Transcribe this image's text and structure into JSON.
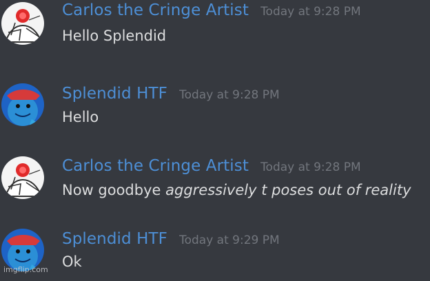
{
  "users": {
    "carlos": "Carlos the Cringe Artist",
    "splendid": "Splendid HTF"
  },
  "messages": [
    {
      "author": "Carlos the Cringe Artist",
      "timestamp": "Today at 9:28 PM",
      "text": "Hello Splendid",
      "avatar_icon": "sketch-character-avatar-icon"
    },
    {
      "author": "Splendid HTF",
      "timestamp": "Today at 9:28 PM",
      "text": "Hello",
      "avatar_icon": "blue-squirrel-avatar-icon"
    },
    {
      "author": "Carlos the Cringe Artist",
      "timestamp": "Today at 9:28 PM",
      "text_plain": "Now goodbye ",
      "text_italic": "aggressively t poses out of reality",
      "avatar_icon": "sketch-character-avatar-icon"
    },
    {
      "author": "Splendid HTF",
      "timestamp": "Today at 9:29 PM",
      "text": "Ok",
      "avatar_icon": "blue-squirrel-avatar-icon"
    }
  ],
  "watermark": "imgflip.com",
  "colors": {
    "background": "#36393f",
    "username": "#4d8fd6",
    "timestamp": "#72767d",
    "message_text": "#dcddde"
  }
}
